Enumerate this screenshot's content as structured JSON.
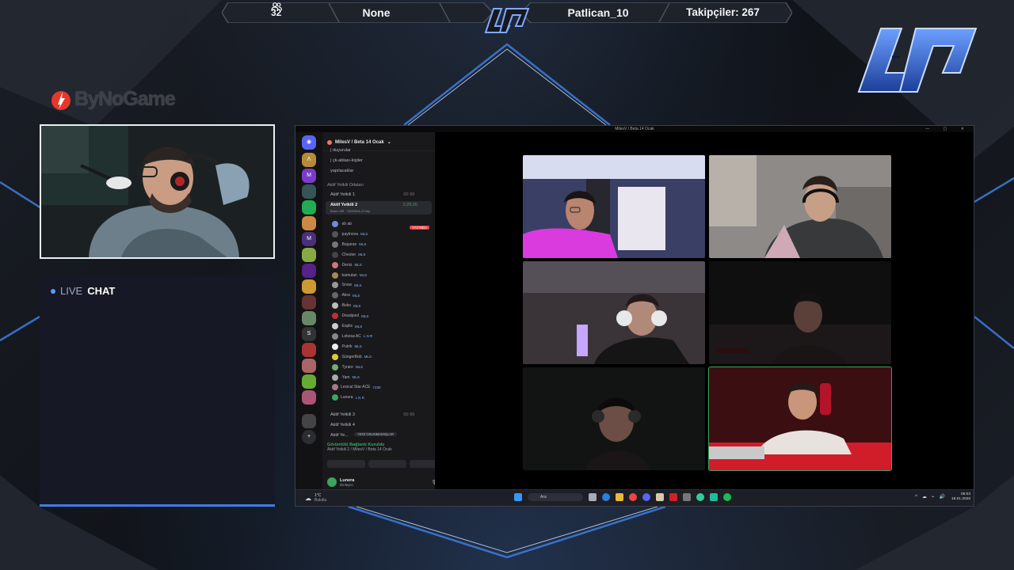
{
  "topbar": {
    "viewer_count": "32",
    "category": "None",
    "username": "Patlican_10",
    "followers": "Takipçiler: 267"
  },
  "sponsor": {
    "name": "ByNoGame"
  },
  "chat": {
    "live": "LIVE",
    "word": "CHAT"
  },
  "discord": {
    "window_title": "MilesV / Beta 14 Ocak",
    "server_name": "MilesV / Beta 14 Ocak",
    "channels": [
      "| duyurular",
      "| çk-ablası-kişiler",
      "yapılacaklar"
    ],
    "category_label": "Aktif Yetkili Odaları",
    "voice_rooms": [
      {
        "name": "Aktif Yetkili 1",
        "meta": "00 99"
      },
      {
        "name": "Aktif Yetkili 2",
        "meta": "2:25:20",
        "activity": "Beta LNR · YAYINDA 22 kişi"
      }
    ],
    "live_badge": "YAYINDA",
    "members": [
      {
        "name": "·sb ab",
        "tag": "",
        "color": "#7289da"
      },
      {
        "name": "·paytnova",
        "tag": "MLS",
        "color": "#555"
      },
      {
        "name": "·Başaran",
        "tag": "MLS",
        "color": "#777"
      },
      {
        "name": "·Chester",
        "tag": "MLS",
        "color": "#444"
      },
      {
        "name": "·Deniz",
        "tag": "MLS",
        "color": "#c77"
      },
      {
        "name": "·kamutan",
        "tag": "MLS",
        "color": "#a85"
      },
      {
        "name": "·Snow",
        "tag": "MLS",
        "color": "#999"
      },
      {
        "name": "·Akra",
        "tag": "MLS",
        "color": "#666"
      },
      {
        "name": "·Boko",
        "tag": "MLS",
        "color": "#bbb"
      },
      {
        "name": "·Deadpool",
        "tag": "MLS",
        "color": "#b33"
      },
      {
        "name": "·Esplis",
        "tag": "MLS",
        "color": "#ccc"
      },
      {
        "name": "·Lekesa AC",
        "tag": "L N R",
        "color": "#888"
      },
      {
        "name": "·Putrik",
        "tag": "MLS",
        "color": "#eee"
      },
      {
        "name": "·SüngerBob",
        "tag": "MLS",
        "color": "#dc3"
      },
      {
        "name": "·Tyraro",
        "tag": "MLS",
        "color": "#7a7"
      },
      {
        "name": "·Yam",
        "tag": "MLS",
        "color": "#aaa"
      },
      {
        "name": "Lexical Star ACE",
        "tag": "7230",
        "color": "#a78"
      },
      {
        "name": "Lunera",
        "tag": "L N R",
        "color": "#3ba55d"
      }
    ],
    "more_rooms": [
      "Aktif Yetkili 3",
      "Aktif Yetkili 4",
      "Aktif Ye..."
    ],
    "more_rooms_meta": "00 99",
    "unread_pill": "YENİ OKUNMAMIŞLAR",
    "voice_status": "Görüntülü Bağlantı Kuruldu",
    "voice_sub": "Aktif Yetkili 2 / MilesV / Beta 14 Ocak",
    "user": {
      "name": "Lunera",
      "status": "Dinleyici"
    }
  },
  "taskbar": {
    "weather_temp": "1°C",
    "weather_desc": "Bulutlu",
    "search_placeholder": "Ara",
    "time": "06:03",
    "date": "18.01.2026"
  },
  "colors": {
    "accent": "#3f7de8",
    "speaking": "#3ba55d",
    "live": "#ed4245"
  }
}
